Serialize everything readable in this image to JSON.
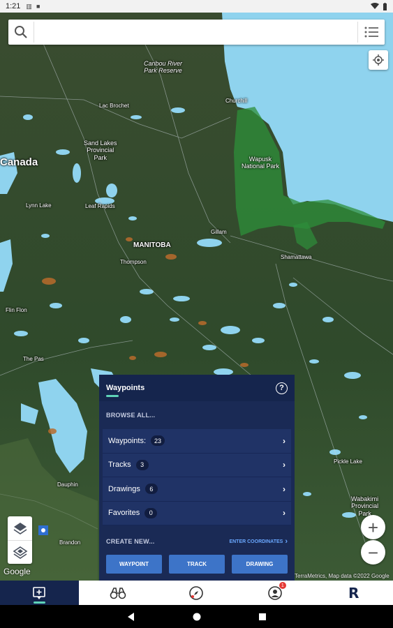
{
  "status_bar": {
    "time": "1:21",
    "icons": [
      "notification-icon",
      "box-icon"
    ],
    "right_icons": [
      "wifi-icon",
      "battery-icon"
    ]
  },
  "search": {
    "placeholder": "",
    "value": ""
  },
  "map": {
    "labels": {
      "caribou": "Caribou River\nPark Reserve",
      "churchill": "Churchill",
      "lac_brochet": "Lac Brochet",
      "sand_lakes": "Sand Lakes\nProvincial\nPark",
      "canada": "Canada",
      "wapusk": "Wapusk\nNational Park",
      "lynn_lake": "Lynn Lake",
      "leaf_rapids": "Leaf Rapids",
      "manitoba": "MANITOBA",
      "gillam": "Gillam",
      "thompson": "Thompson",
      "shamattawa": "Shamattawa",
      "flin_flon": "Flin Flon",
      "the_pas": "The Pas",
      "dauphin": "Dauphin",
      "brandon": "Brandon",
      "wabakimi": "Wabakimi\nProvincial\nPark",
      "pickle_lake": "Pickle Lake"
    },
    "google": "Google",
    "attribution": "TerraMetrics, Map data ©2022 Google"
  },
  "panel": {
    "title": "Waypoints",
    "help": "?",
    "browse_label": "BROWSE ALL...",
    "rows": [
      {
        "label": "Waypoints:",
        "count": "23"
      },
      {
        "label": "Tracks",
        "count": "3"
      },
      {
        "label": "Drawings",
        "count": "6"
      },
      {
        "label": "Favorites",
        "count": "0"
      }
    ],
    "create_label": "CREATE NEW...",
    "enter_coords": "ENTER COORDINATES",
    "buttons": {
      "waypoint": "WAYPOINT",
      "track": "TRACK",
      "drawing": "DRAWING"
    }
  },
  "zoom": {
    "in": "+",
    "out": "−"
  },
  "bottom_nav": {
    "badge": "1",
    "logo": "R"
  },
  "colors": {
    "panel": "#15254d",
    "accent": "#5fd3b8",
    "button": "#3d74c8",
    "water": "#8fd3ee",
    "land": "#2f4628"
  }
}
